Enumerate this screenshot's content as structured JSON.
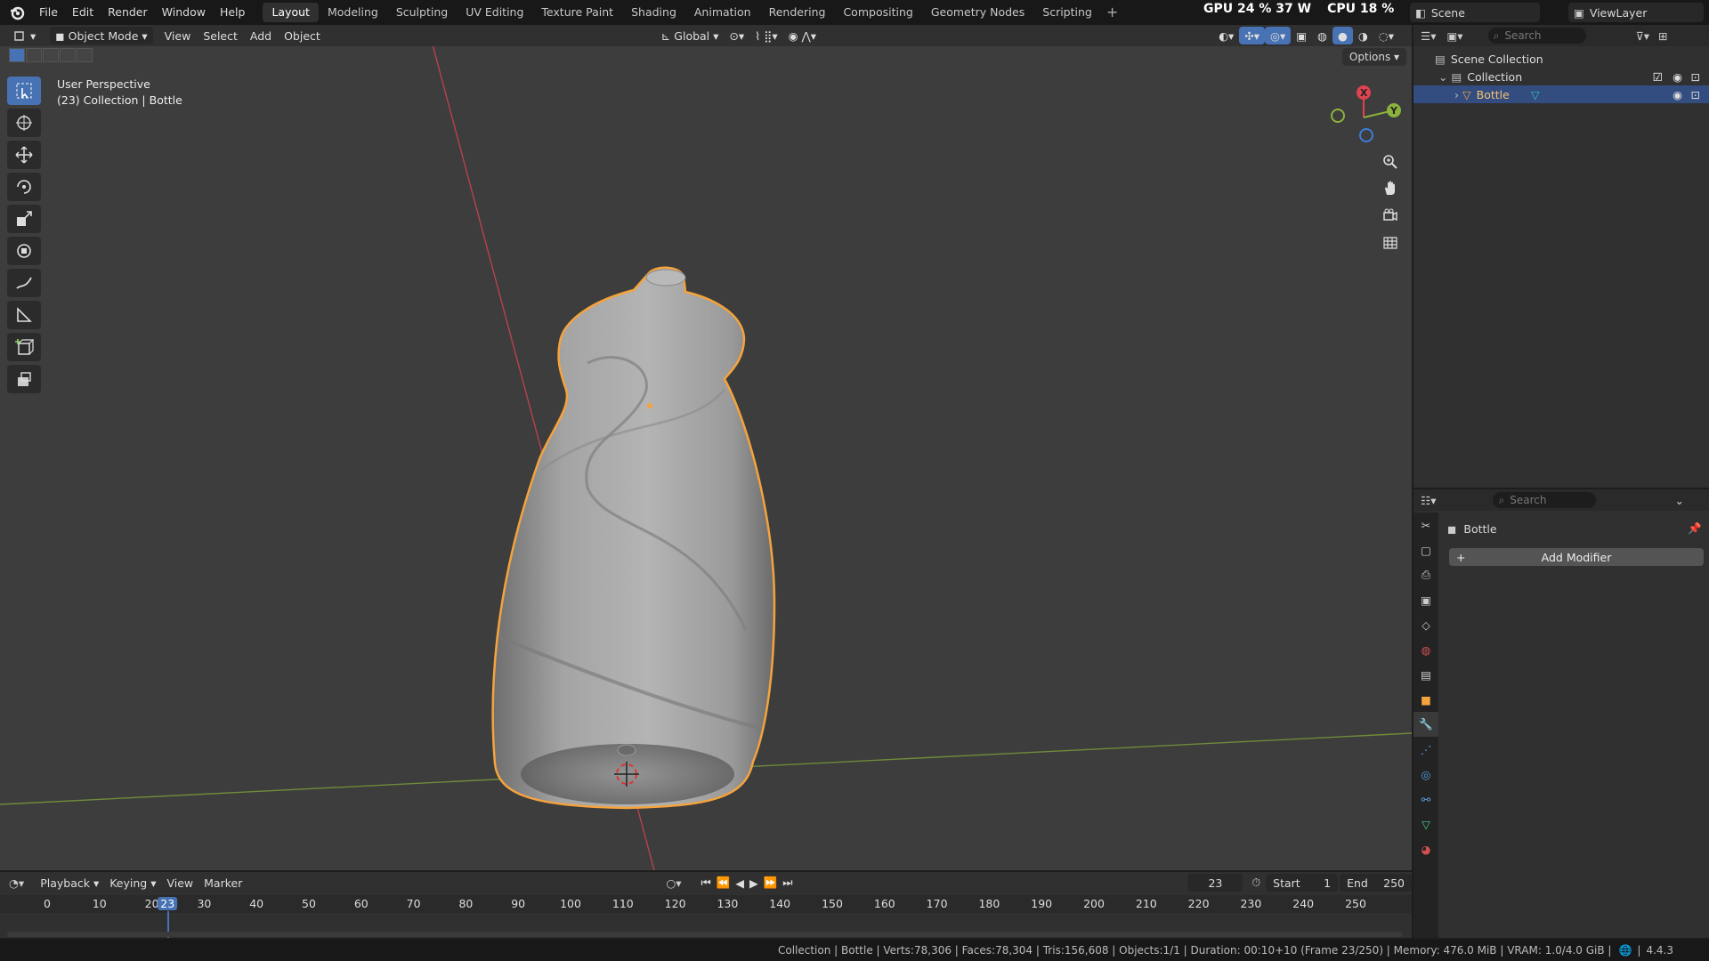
{
  "app": {
    "menus": [
      "File",
      "Edit",
      "Render",
      "Window",
      "Help"
    ]
  },
  "workspaces": [
    "Layout",
    "Modeling",
    "Sculpting",
    "UV Editing",
    "Texture Paint",
    "Shading",
    "Animation",
    "Rendering",
    "Compositing",
    "Geometry Nodes",
    "Scripting"
  ],
  "active_workspace": "Layout",
  "perf": {
    "gpu": "GPU 24 % 37 W",
    "cpu": "CPU 18 %"
  },
  "scene": {
    "name": "Scene"
  },
  "view_layer": {
    "name": "ViewLayer"
  },
  "viewport": {
    "mode": "Object Mode",
    "menus": [
      "View",
      "Select",
      "Add",
      "Object"
    ],
    "transform_orientation": "Global",
    "options_label": "Options",
    "perspective": "User Perspective",
    "context": "(23) Collection | Bottle"
  },
  "gizmo": {
    "x": "X",
    "y": "Y"
  },
  "outliner": {
    "search_placeholder": "Search",
    "scene_collection": "Scene Collection",
    "collection": "Collection",
    "object": "Bottle"
  },
  "properties": {
    "search_placeholder": "Search",
    "object_name": "Bottle",
    "add_modifier": "Add Modifier"
  },
  "timeline": {
    "menus": [
      "Playback",
      "Keying",
      "View",
      "Marker"
    ],
    "current_frame": "23",
    "start_label": "Start",
    "start": "1",
    "end_label": "End",
    "end": "250",
    "ticks": [
      "0",
      "10",
      "20",
      "30",
      "40",
      "50",
      "60",
      "70",
      "80",
      "90",
      "100",
      "110",
      "120",
      "130",
      "140",
      "150",
      "160",
      "170",
      "180",
      "190",
      "200",
      "210",
      "220",
      "230",
      "240",
      "250"
    ]
  },
  "status": {
    "text": "Collection | Bottle | Verts:78,306 | Faces:78,304 | Tris:156,608 | Objects:1/1 | Duration: 00:10+10 (Frame 23/250) | Memory: 476.0 MiB | VRAM: 1.0/4.0 GiB |",
    "version": "4.4.3"
  },
  "colors": {
    "accent": "#4772b3",
    "selection_outline": "#f5a33c",
    "x_axis": "#e0434f",
    "y_axis": "#8bb33c",
    "z_axis": "#3d7dd8"
  }
}
